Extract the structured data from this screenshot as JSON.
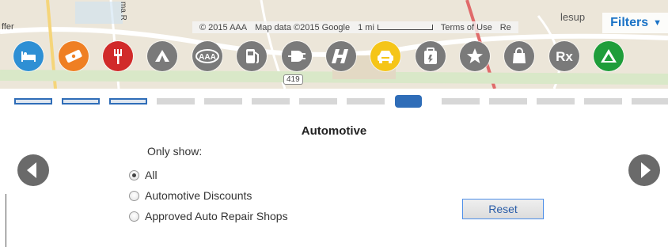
{
  "map": {
    "place_left": "ffer",
    "road_vertical": "ma R",
    "place_right": "lesup",
    "route_shield": "419",
    "attribution": {
      "copyright": "© 2015 AAA",
      "map_data": "Map data ©2015 Google",
      "scale_label": "1 mi",
      "terms": "Terms of Use",
      "report": "Re"
    }
  },
  "filters_button": {
    "label": "Filters",
    "caret": "▼"
  },
  "categories": [
    {
      "icon": "lodging-icon",
      "color": "#2e8fd4",
      "selected": false
    },
    {
      "icon": "ticket-icon",
      "color": "#ef7f23",
      "selected": false
    },
    {
      "icon": "dining-icon",
      "color": "#d12a2a",
      "selected": false
    },
    {
      "icon": "camping-icon",
      "color": "#7a7a7a",
      "selected": false
    },
    {
      "icon": "aaa-icon",
      "color": "#7a7a7a",
      "selected": false,
      "text": "AAA"
    },
    {
      "icon": "gas-icon",
      "color": "#7a7a7a",
      "selected": false
    },
    {
      "icon": "ev-charging-icon",
      "color": "#7a7a7a",
      "selected": false
    },
    {
      "icon": "hertz-icon",
      "color": "#7a7a7a",
      "selected": false
    },
    {
      "icon": "automotive-icon",
      "color": "#f5c518",
      "selected": true
    },
    {
      "icon": "travel-store-icon",
      "color": "#7a7a7a",
      "selected": false
    },
    {
      "icon": "attractions-icon",
      "color": "#7a7a7a",
      "selected": false
    },
    {
      "icon": "shopping-icon",
      "color": "#7a7a7a",
      "selected": false
    },
    {
      "icon": "pharmacy-icon",
      "color": "#7a7a7a",
      "selected": false,
      "text": "Rx"
    },
    {
      "icon": "campground-icon",
      "color": "#1f9d3a",
      "selected": false
    }
  ],
  "pager": {
    "total": 14,
    "current_index": 8,
    "visited": [
      0,
      1,
      2
    ]
  },
  "panel": {
    "title": "Automotive",
    "only_show": "Only show:",
    "options": [
      {
        "label": "All",
        "checked": true
      },
      {
        "label": "Automotive Discounts",
        "checked": false
      },
      {
        "label": "Approved Auto Repair Shops",
        "checked": false
      }
    ],
    "reset_label": "Reset"
  }
}
